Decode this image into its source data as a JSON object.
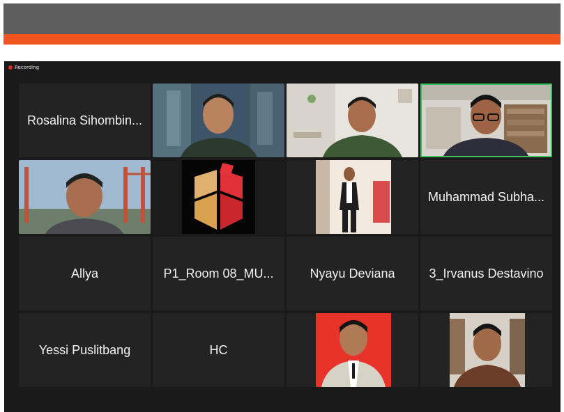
{
  "recording": {
    "label": "Recording"
  },
  "participants": {
    "rosalina": "Rosalina Sihombin...",
    "muhammad": "Muhammad Subha...",
    "allya": "Allya",
    "room": "P1_Room 08_MU...",
    "nyayu": "Nyayu Deviana",
    "irvanus": "3_Irvanus Destavino",
    "yessi": "Yessi Puslitbang",
    "hc": "HC"
  },
  "colors": {
    "slide_bar": "#5e5e5e",
    "slide_accent": "#f0551f",
    "meeting_bg": "#1a1a1a",
    "tile_bg": "#232323",
    "active_speaker": "#3cc25a",
    "recording_dot": "#e0281e"
  },
  "icons": {
    "recording": "recording-dot-icon"
  }
}
